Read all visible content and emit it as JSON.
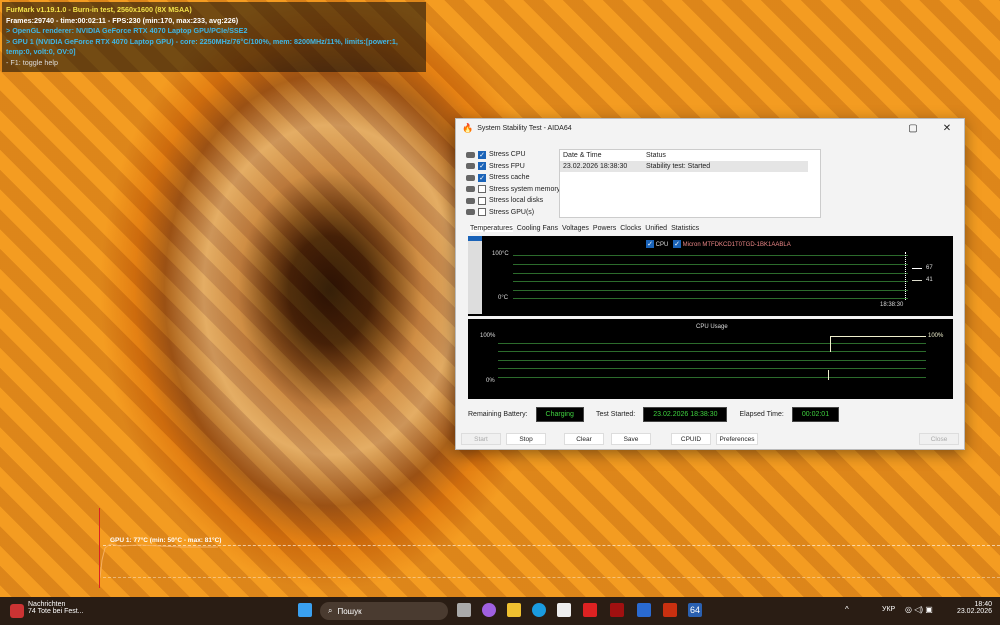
{
  "osd": {
    "line1": "FurMark v1.19.1.0 - Burn-in test, 2560x1600 (8X MSAA)",
    "line2": "Frames:29740 - time:00:02:11 - FPS:230 (min:170, max:233, avg:226)",
    "line3": "> OpenGL renderer: NVIDIA GeForce RTX 4070 Laptop GPU/PCIe/SSE2",
    "line4": "> GPU 1 (NVIDIA GeForce RTX 4070 Laptop GPU) - core: 2250MHz/76°C/100%, mem: 8200MHz/11%, limits:[power:1, temp:0, volt:0, OV:0]",
    "line5": "- F1: toggle help"
  },
  "gpu_graph": {
    "label": "GPU 1: 77°C (min: 50°C - max: 81°C)"
  },
  "window": {
    "title": "System Stability Test - AIDA64",
    "options": [
      {
        "label": "Stress CPU",
        "checked": true
      },
      {
        "label": "Stress FPU",
        "checked": true
      },
      {
        "label": "Stress cache",
        "checked": true
      },
      {
        "label": "Stress system memory",
        "checked": false
      },
      {
        "label": "Stress local disks",
        "checked": false
      },
      {
        "label": "Stress GPU(s)",
        "checked": false
      }
    ],
    "log": {
      "headers": [
        "Date & Time",
        "Status"
      ],
      "rows": [
        [
          "23.02.2026 18:38:30",
          "Stability test: Started"
        ]
      ]
    },
    "tabs": [
      "Temperatures",
      "Cooling Fans",
      "Voltages",
      "Powers",
      "Clocks",
      "Unified",
      "Statistics"
    ],
    "temp_chart": {
      "legend": [
        "CPU",
        "Micron MTFDKCD1T0TGD-1BK1AABLA"
      ],
      "ymax": "100°C",
      "ymin": "0°C",
      "time": "18:38:30",
      "values": [
        "67",
        "41"
      ]
    },
    "usage_chart": {
      "title": "CPU Usage",
      "ymax": "100%",
      "ymin": "0%",
      "value": "100%"
    },
    "status": {
      "battery_label": "Remaining Battery:",
      "battery": "Charging",
      "started_label": "Test Started:",
      "started": "23.02.2026 18:38:30",
      "elapsed_label": "Elapsed Time:",
      "elapsed": "00:02:01"
    },
    "buttons": {
      "start": "Start",
      "stop": "Stop",
      "clear": "Clear",
      "save": "Save",
      "cpuid": "CPUID",
      "prefs": "Preferences",
      "close": "Close"
    }
  },
  "taskbar": {
    "news_title": "Nachrichten",
    "news_sub": "74 Tote bei Fest...",
    "search": "Пошук",
    "lang": "УКР",
    "time": "18:40",
    "date": "23.02.2026",
    "aida": "64"
  }
}
